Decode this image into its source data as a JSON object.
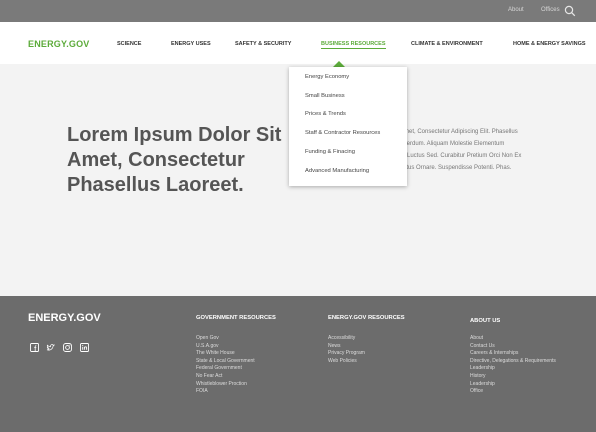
{
  "utility": {
    "links": [
      "About",
      "Offices"
    ],
    "search_icon": "search-icon"
  },
  "nav": {
    "logo": "ENERGY.GOV",
    "items": [
      "SCIENCE",
      "ENERGY USES",
      "SAFETY & SECURITY",
      "BUSINESS RESOURCES",
      "CLIMATE & ENVIRONMENT",
      "HOME & ENERGY SAVINGS"
    ],
    "active_item": "BUSINESS RESOURCES"
  },
  "dropdown": {
    "items": [
      "Energy  Economy",
      "Small Business",
      "Prices & Trends",
      "Staff & Contractor Resources",
      "Funding & Finacing",
      "Advanced Manufacturing"
    ]
  },
  "hero": {
    "title": "Lorem Ipsum Dolor Sit Amet, Consectetur Phasellus Laoreet.",
    "body_lines": [
      "Amet, Consectetur Adipiscing Elit. Phasellus",
      "Interdum. Aliquam Molestie Elementum",
      "ro Luctus Sed. Curabitur Pretium Orci Non Ex",
      "ectus Ornare. Suspendisse Potenti. Phas."
    ]
  },
  "footer": {
    "logo": "ENERGY.GOV",
    "social_icons": [
      "facebook-icon",
      "twitter-icon",
      "instagram-icon",
      "linkedin-icon"
    ],
    "columns": [
      {
        "heading": "GOVERNMENT RESOURCES",
        "links": [
          "Open Gov",
          "U.S.A.gov",
          "The White House",
          "State & Local Government",
          "Federal Government",
          "No Fear Act",
          "Whistleblower Proction",
          "FOIA"
        ]
      },
      {
        "heading": "ENERGY.GOV RESOURCES",
        "links": [
          "Accessibility",
          "News",
          "Privacy Program",
          "Web Policies"
        ]
      },
      {
        "heading": "ABOUT US",
        "links": [
          "About",
          "Contact Us",
          "Careers & Internships",
          "Directive, Delegations & Requirements",
          "Leadership",
          "History",
          "Leadership",
          "Office"
        ]
      }
    ]
  },
  "colors": {
    "brand_green": "#5cab3a",
    "utility_bar": "#7a7a7a",
    "hero_bg": "#f3f3f3",
    "footer_bg": "#6c6c6c"
  }
}
